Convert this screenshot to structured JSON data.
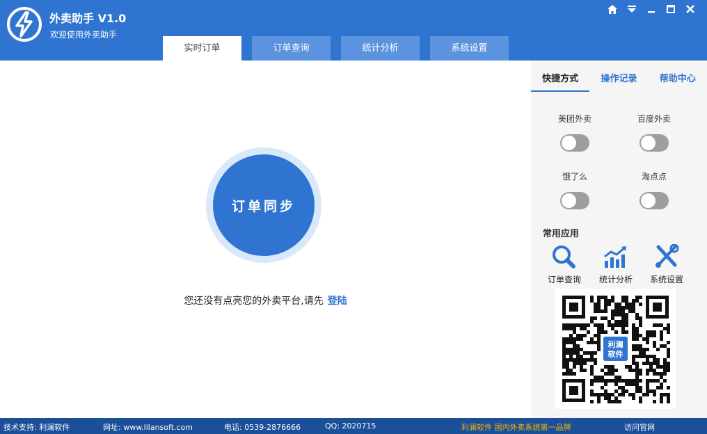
{
  "header": {
    "app_title": "外卖助手 V1.0",
    "app_subtitle": "欢迎使用外卖助手",
    "tabs": [
      {
        "label": "实时订单"
      },
      {
        "label": "订单查询"
      },
      {
        "label": "统计分析"
      },
      {
        "label": "系统设置"
      }
    ],
    "active_tab": 0,
    "window_controls": [
      "home-icon",
      "dropdown-icon",
      "minimize-icon",
      "maximize-icon",
      "close-icon"
    ]
  },
  "main": {
    "sync_button_label": "订单同步",
    "notice_text": "您还没有点亮您的外卖平台,请先",
    "login_link": "登陆"
  },
  "side": {
    "tabs": [
      {
        "label": "快捷方式"
      },
      {
        "label": "操作记录"
      },
      {
        "label": "帮助中心"
      }
    ],
    "active_tab": 0,
    "platforms": [
      {
        "label": "美团外卖",
        "enabled": false
      },
      {
        "label": "百度外卖",
        "enabled": false
      },
      {
        "label": "饿了么",
        "enabled": false
      },
      {
        "label": "淘点点",
        "enabled": false
      }
    ],
    "apps_title": "常用应用",
    "apps": [
      {
        "label": "订单查询",
        "icon": "search-icon"
      },
      {
        "label": "统计分析",
        "icon": "chart-icon"
      },
      {
        "label": "系统设置",
        "icon": "tools-icon"
      }
    ],
    "qr_center_text": [
      "利澜",
      "软件"
    ]
  },
  "footer": {
    "support": "技术支持: 利澜软件",
    "website": "网址: www.lilansoft.com",
    "phone": "电话: 0539-2876666",
    "qq": "QQ: 2020715",
    "slogan": "利澜软件  国内外卖系统第一品牌",
    "visit_link": "访问官网"
  },
  "colors": {
    "primary": "#2f74d0",
    "footer_bg": "#1b4f99",
    "slogan": "#f5b400"
  }
}
